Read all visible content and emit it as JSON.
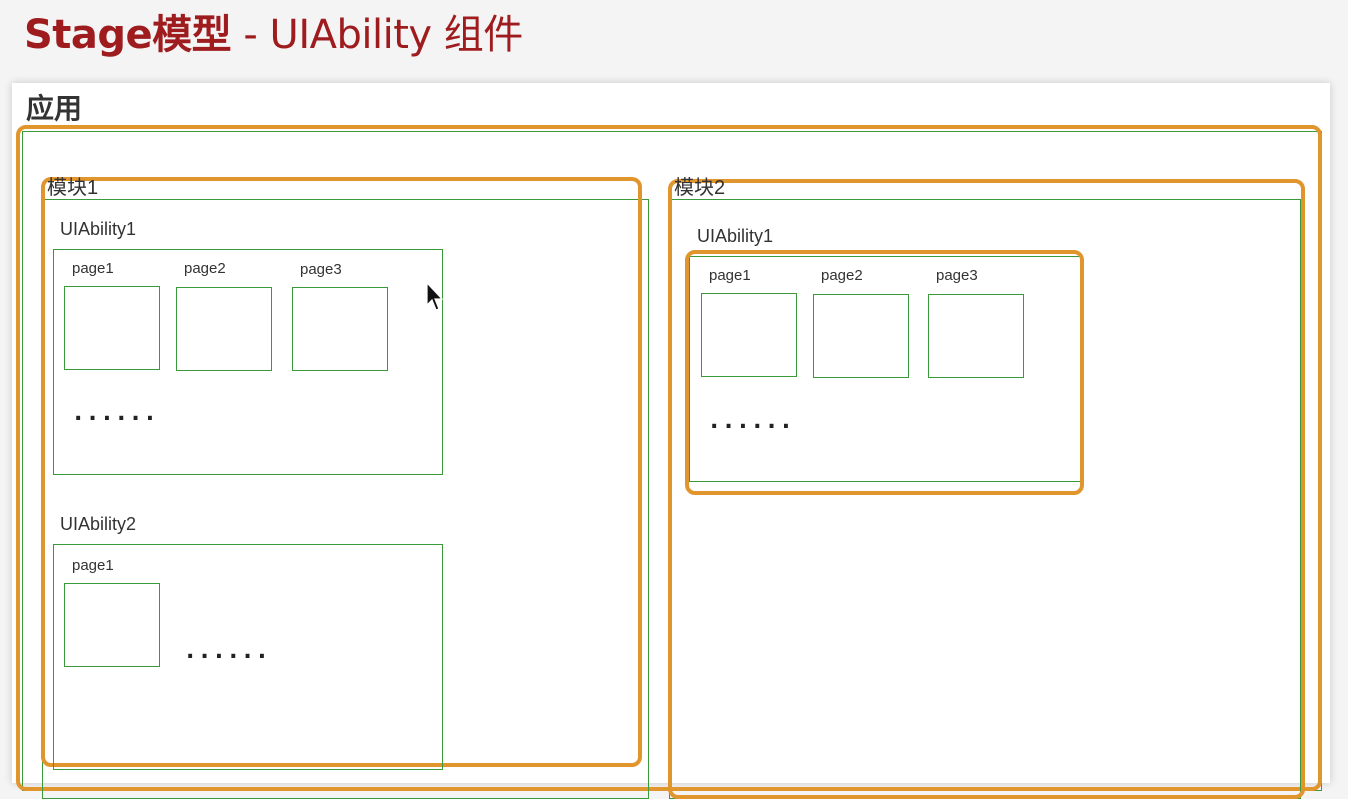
{
  "title": {
    "bold": "Stage模型",
    "light": " - UIAbility 组件"
  },
  "app": {
    "label": "应用"
  },
  "modules": [
    {
      "label": "模块1",
      "abilities": [
        {
          "label": "UIAbility1",
          "pages": [
            "page1",
            "page2",
            "page3"
          ],
          "ellipsis": "......"
        },
        {
          "label": "UIAbility2",
          "pages": [
            "page1"
          ],
          "ellipsis": "......"
        }
      ]
    },
    {
      "label": "模块2",
      "abilities": [
        {
          "label": "UIAbility1",
          "pages": [
            "page1",
            "page2",
            "page3"
          ],
          "ellipsis": "......"
        }
      ]
    }
  ],
  "colors": {
    "title": "#9e1b1e",
    "green_border": "#3a9a3a",
    "orange_highlight": "#e0952d"
  }
}
